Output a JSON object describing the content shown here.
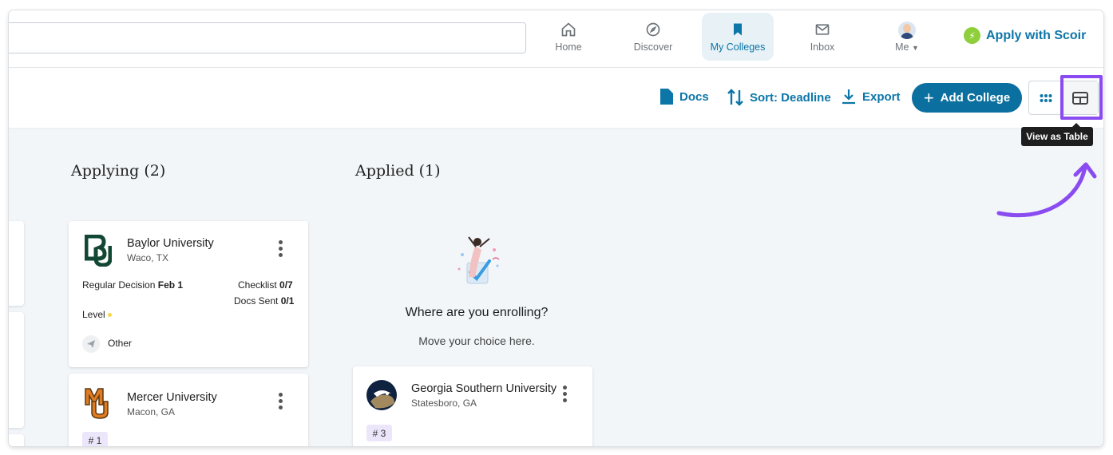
{
  "nav": {
    "items": [
      {
        "label": "Home",
        "icon": "home-icon"
      },
      {
        "label": "Discover",
        "icon": "compass-icon"
      },
      {
        "label": "My Colleges",
        "icon": "bookmark-icon"
      },
      {
        "label": "Inbox",
        "icon": "mail-icon"
      },
      {
        "label": "Me",
        "icon": "avatar"
      }
    ],
    "apply_label": "Apply with Scoir"
  },
  "toolbar": {
    "docs_label": "Docs",
    "sort_label": "Sort: Deadline",
    "export_label": "Export",
    "add_label": "Add College",
    "tooltip": "View as Table"
  },
  "colors": {
    "accent": "#0c76a8",
    "button": "#0b6f9f",
    "highlight": "#8a4cf0",
    "level_dot": "#f5d74a"
  },
  "columns": [
    {
      "title": "Applying (2)",
      "cards": [
        {
          "name": "Baylor University",
          "location": "Waco, TX",
          "decision_label": "Regular Decision",
          "decision_date": "Feb 1",
          "checklist_label": "Checklist",
          "checklist_value": "0/7",
          "docs_label": "Docs Sent",
          "docs_value": "0/1",
          "level_label": "Level",
          "type_label": "Other"
        },
        {
          "name": "Mercer University",
          "location": "Macon, GA",
          "rank": "# 1"
        }
      ]
    },
    {
      "title": "Applied (1)",
      "enroll_title": "Where are you enrolling?",
      "enroll_subtitle": "Move your choice here.",
      "cards": [
        {
          "name": "Georgia Southern University",
          "location": "Statesboro, GA",
          "rank": "# 3"
        }
      ]
    }
  ]
}
